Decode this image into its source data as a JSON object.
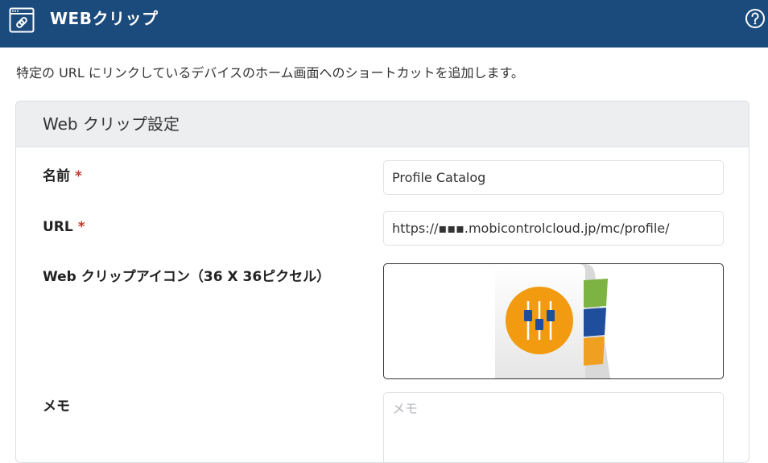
{
  "header": {
    "title": "WEBクリップ",
    "icon": "web-link-icon",
    "help_icon": "help-circle-icon"
  },
  "description": "特定の URL にリンクしているデバイスのホーム画面へのショートカットを追加します。",
  "panel": {
    "title": "Web クリップ設定"
  },
  "fields": {
    "name": {
      "label": "名前",
      "required_mark": "*",
      "value": "Profile Catalog"
    },
    "url": {
      "label": "URL",
      "required_mark": "*",
      "value": "https://▪▪▪.mobicontrolcloud.jp/mc/profile/"
    },
    "icon": {
      "label": "Web クリップアイコン（36 X 36ピクセル）"
    },
    "memo": {
      "label": "メモ",
      "placeholder": "メモ",
      "value": ""
    }
  },
  "colors": {
    "header_bg": "#1b4b7d",
    "required": "#c0392b",
    "icon_orange": "#f29a10",
    "icon_green": "#7cb342",
    "icon_blue": "#1f4e9c",
    "icon_orange_strip": "#f0a020"
  }
}
